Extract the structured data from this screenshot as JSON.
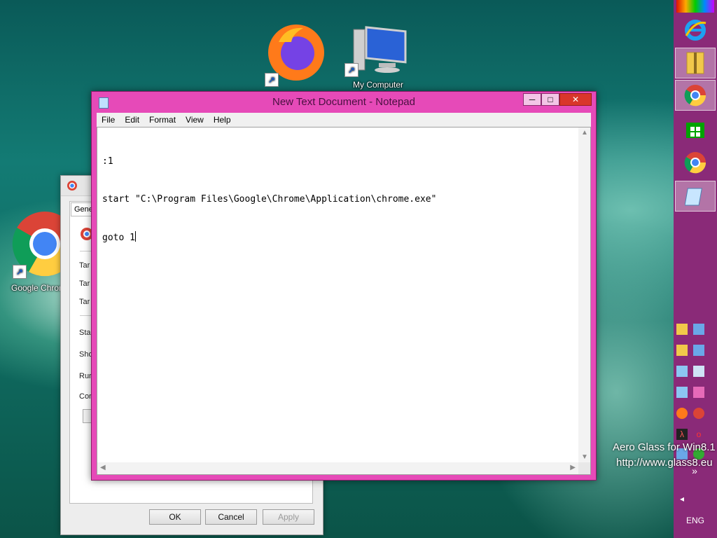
{
  "desktop": {
    "icons": [
      {
        "label": "My Computer",
        "icon": "computer-icon"
      },
      {
        "label": "Google Chrome",
        "icon": "chrome-icon"
      },
      {
        "label": "",
        "icon": "firefox-icon"
      }
    ],
    "watermark": {
      "line1": "Aero Glass for Win8.1",
      "line2": "http://www.glass8.eu"
    }
  },
  "notepad": {
    "title": "New Text Document - Notepad",
    "menu": [
      "File",
      "Edit",
      "Format",
      "View",
      "Help"
    ],
    "lines": [
      ":1",
      "start \"C:\\Program Files\\Google\\Chrome\\Application\\chrome.exe\"",
      "goto 1"
    ],
    "controls": {
      "minimize": "─",
      "maximize": "□",
      "close": "✕"
    }
  },
  "properties_dialog": {
    "tab": "Gene",
    "labels": [
      "Tar",
      "Tar",
      "Tar",
      "Sta",
      "Sho",
      "Rur",
      "Cor"
    ],
    "buttons": {
      "ok": "OK",
      "cancel": "Cancel",
      "apply": "Apply"
    }
  },
  "taskbar": {
    "language": "ENG",
    "chevron": "»",
    "left_arrow": "◂"
  },
  "colors": {
    "accent": "#e64ab8",
    "taskbar": "#8a2a78"
  }
}
